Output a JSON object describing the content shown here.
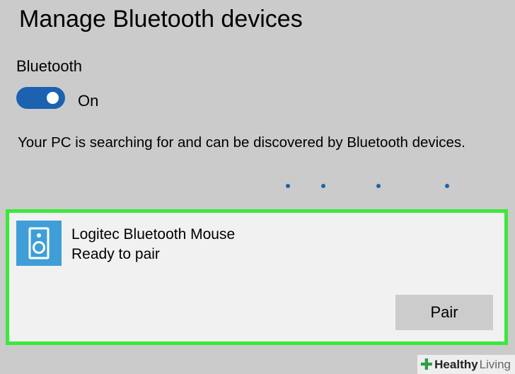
{
  "header": {
    "title": "Manage Bluetooth devices"
  },
  "bluetooth": {
    "label": "Bluetooth",
    "toggle_state": "On",
    "toggle_on": true,
    "accent_color": "#1c62b0"
  },
  "search": {
    "status_text": "Your PC is searching for and can be discovered by Bluetooth devices."
  },
  "device": {
    "name": "Logitec Bluetooth Mouse",
    "status": "Ready to pair",
    "icon": "speaker-icon",
    "icon_color": "#3f9ed8",
    "highlight_color": "#3ce83c",
    "pair_label": "Pair"
  },
  "watermark": {
    "brand_bold": "Healthy",
    "brand_light": "Living"
  }
}
